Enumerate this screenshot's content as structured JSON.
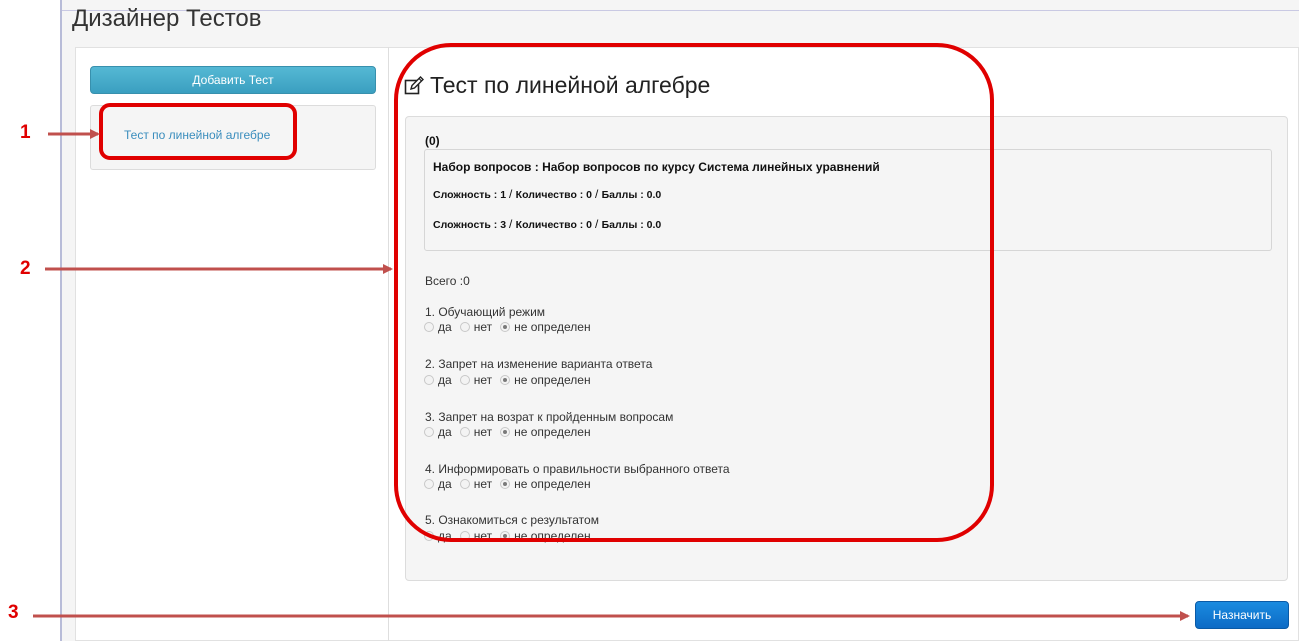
{
  "app": {
    "title": "Дизайнер Тестов"
  },
  "sidebar": {
    "add_button_label": "Добавить Тест",
    "tests": [
      {
        "label": "Тест по линейной алгебре"
      }
    ]
  },
  "main": {
    "title": "Тест по линейной алгебре",
    "count_label": "(0)",
    "question_set": {
      "title": "Набор вопросов : Набор вопросов по курсу Система линейных уравнений",
      "rows": [
        {
          "difficulty": "Сложность : 1",
          "quantity": "Количество : 0",
          "points": "Баллы : 0.0"
        },
        {
          "difficulty": "Сложность : 3",
          "quantity": "Количество : 0",
          "points": "Баллы : 0.0"
        }
      ]
    },
    "total": "Всего :0",
    "option_choices": {
      "yes": "да",
      "no": "нет",
      "undefined": "не определен"
    },
    "options": [
      {
        "title": "1. Обучающий режим",
        "selected": "не определен"
      },
      {
        "title": "2. Запрет на изменение варианта ответа",
        "selected": "не определен"
      },
      {
        "title": "3. Запрет на возрат к пройденным вопросам",
        "selected": "не определен"
      },
      {
        "title": "4. Информировать о правильности выбранного ответа",
        "selected": "не определен"
      },
      {
        "title": "5. Ознакомиться с результатом",
        "selected": "не определен"
      }
    ],
    "assign_button_label": "Назначить"
  },
  "annotations": {
    "markers": [
      "1",
      "2",
      "3"
    ],
    "colors": {
      "arrow": "#c0504d",
      "highlight": "#e00000"
    }
  }
}
